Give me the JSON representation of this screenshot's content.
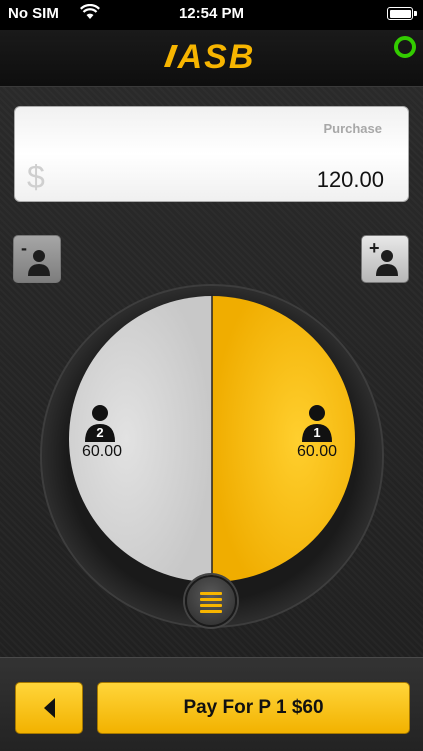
{
  "status_bar": {
    "carrier": "No SIM",
    "time": "12:54 PM"
  },
  "header": {
    "brand": "ASB",
    "brand_color": "#f7b500",
    "online_color": "#33cc00"
  },
  "amount": {
    "label": "Purchase",
    "currency_icon": "$",
    "value": "120.00"
  },
  "controls": {
    "remove_sign": "-",
    "add_sign": "+"
  },
  "split": {
    "shares": [
      {
        "person": "2",
        "amount": "60.00",
        "color": "#d6d6d6",
        "fraction": 0.5
      },
      {
        "person": "1",
        "amount": "60.00",
        "color": "#f7b500",
        "fraction": 0.5
      }
    ]
  },
  "footer": {
    "pay_label": "Pay For P 1 $60"
  }
}
